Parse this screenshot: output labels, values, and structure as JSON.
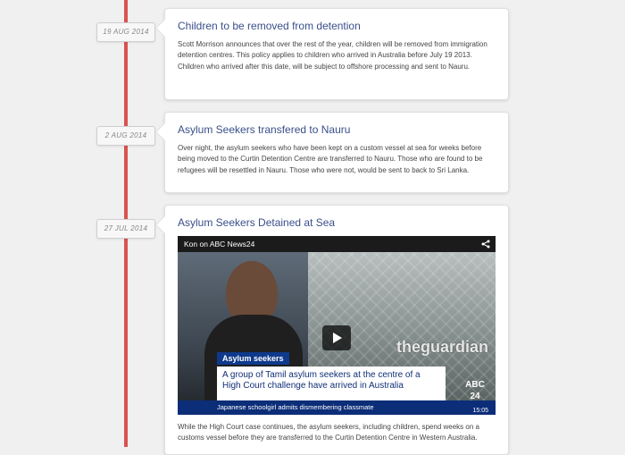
{
  "timeline": {
    "line_color": "#d9534f",
    "entries": [
      {
        "date": "19 AUG 2014",
        "title": "Children to be removed from detention",
        "text": "Scott Morrison announces that over the rest of the year, children will be removed from immigration detention centres. This policy applies to children who arrived in Australia before July 19 2013. Children who arrived after this date, will be subject to offshore processing and sent to Nauru."
      },
      {
        "date": "2 AUG 2014",
        "title": "Asylum Seekers transfered to Nauru",
        "text": "Over night, the asylum seekers who have been kept on a custom vessel at sea for weeks before being moved to the Curtin Detention Centre are transferred to Nauru. Those who are found to be refugees will be resettled in Nauru. Those who were not, would be sent to back to Sri Lanka."
      },
      {
        "date": "27 JUL 2014",
        "title": "Asylum Seekers Detained at Sea",
        "video": {
          "title": "Kon on ABC News24",
          "label": "Asylum seekers",
          "headline": "A group of Tamil asylum seekers at the centre of a High Court challenge have arrived in Australia",
          "ticker": "Japanese schoolgirl admits dismembering classmate",
          "watermark": "theguardian",
          "channel": "ABC 24",
          "time": "15:05"
        },
        "text": "While the High Court case continues, the asylum seekers, including children, spend weeks on a customs vessel before they are transferred to the Curtin Detention Centre in Western Australia."
      }
    ]
  }
}
